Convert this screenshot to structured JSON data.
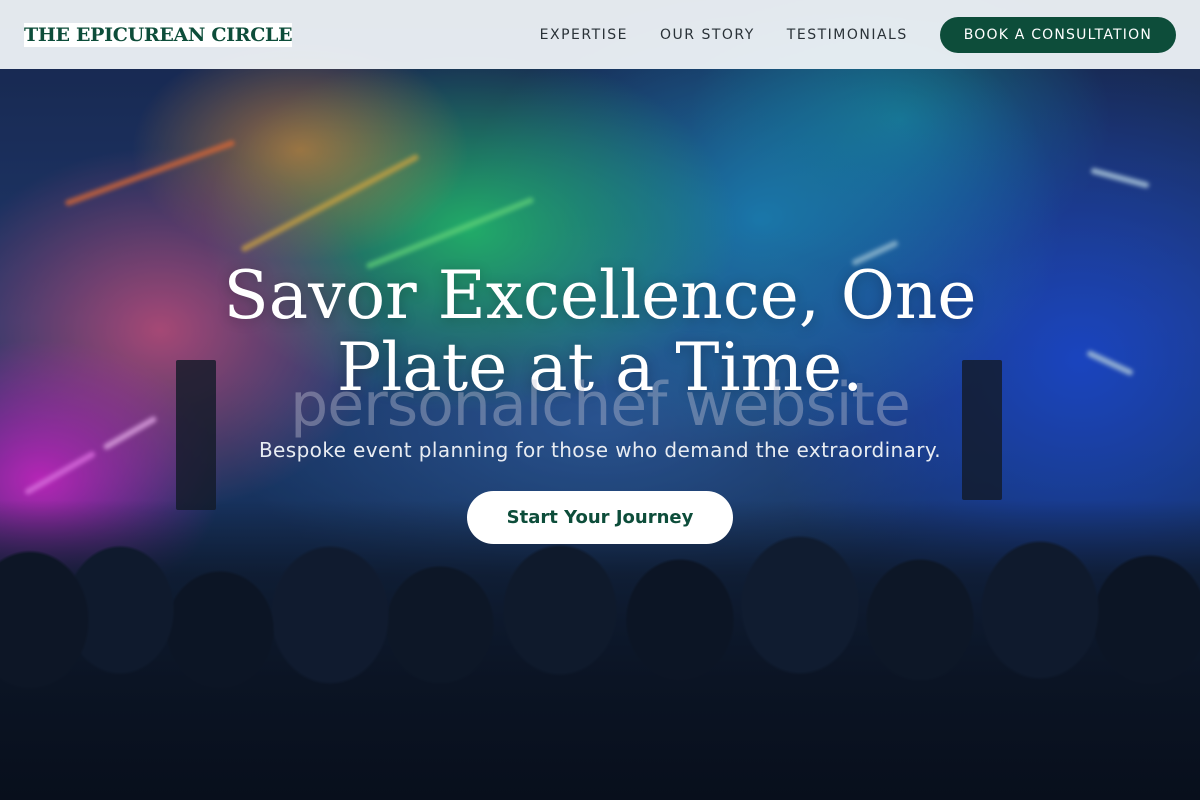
{
  "brand": {
    "name": "THE EPICUREAN CIRCLE"
  },
  "nav": {
    "links": [
      {
        "label": "EXPERTISE"
      },
      {
        "label": "OUR STORY"
      },
      {
        "label": "TESTIMONIALS"
      }
    ],
    "cta_label": "BOOK A CONSULTATION"
  },
  "hero": {
    "headline": "Savor Excellence, One Plate at a Time.",
    "watermark": "personalchef website",
    "subtitle": "Bespoke event planning for those who demand the extraordinary.",
    "button_label": "Start Your Journey"
  },
  "colors": {
    "brand_green": "#0d4d3a",
    "nav_background": "#f0f4f8",
    "button_background": "#ffffff"
  }
}
